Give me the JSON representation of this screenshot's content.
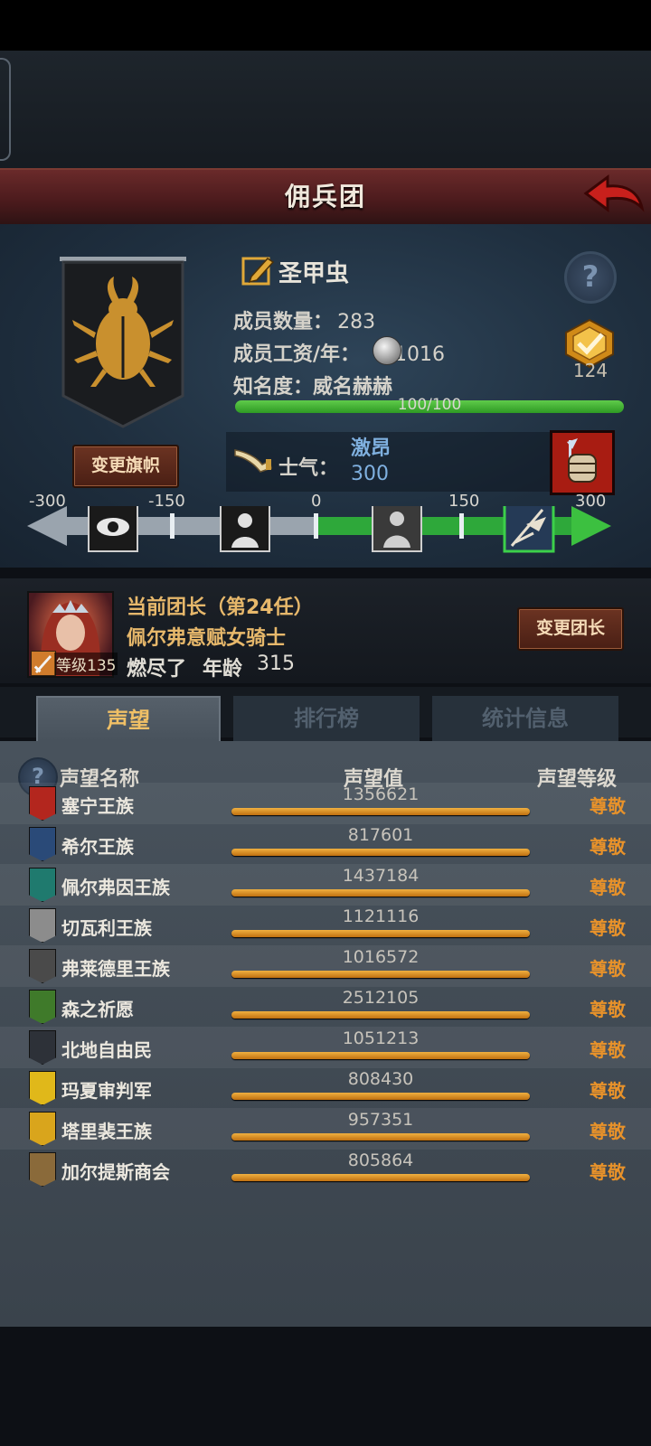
{
  "header": {
    "title": "佣兵团"
  },
  "guild": {
    "banner_button": "变更旗帜",
    "name": "圣甲虫",
    "members_label": "成员数量：",
    "members_value": "283",
    "wage_label": "成员工资/年：",
    "wage_value": "1016",
    "fame_label": "知名度：",
    "fame_value": "威名赫赫",
    "fame_progress": "100/100",
    "fame_fraction": 1.0,
    "rank_badge_value": "124",
    "morale_label": "士气：",
    "morale_state": "激昂",
    "morale_value": "300"
  },
  "morale_track": {
    "ticks": [
      "-300",
      "-150",
      "0",
      "150",
      "300"
    ],
    "current_value": 300
  },
  "leader": {
    "title": "当前团长（第24任）",
    "name": "佩尔弗意赋女骑士",
    "level_label": "等级135",
    "state": "燃尽了",
    "age_label": "年龄",
    "age_value": "315",
    "change_button": "变更团长"
  },
  "tabs": {
    "reputation": "声望",
    "ranking": "排行榜",
    "stats": "统计信息"
  },
  "table": {
    "col_name": "声望名称",
    "col_value": "声望值",
    "col_level": "声望等级",
    "rows": [
      {
        "name": "塞宁王族",
        "value": "1356621",
        "level": "尊敬",
        "emblem_color": "#b3261e"
      },
      {
        "name": "希尔王族",
        "value": "817601",
        "level": "尊敬",
        "emblem_color": "#2a4a78"
      },
      {
        "name": "佩尔弗因王族",
        "value": "1437184",
        "level": "尊敬",
        "emblem_color": "#1f7a6e"
      },
      {
        "name": "切瓦利王族",
        "value": "1121116",
        "level": "尊敬",
        "emblem_color": "#8c8c8c"
      },
      {
        "name": "弗莱德里王族",
        "value": "1016572",
        "level": "尊敬",
        "emblem_color": "#4a4a4a"
      },
      {
        "name": "森之祈愿",
        "value": "2512105",
        "level": "尊敬",
        "emblem_color": "#3f7a2a"
      },
      {
        "name": "北地自由民",
        "value": "1051213",
        "level": "尊敬",
        "emblem_color": "#2d3138"
      },
      {
        "name": "玛夏审判军",
        "value": "808430",
        "level": "尊敬",
        "emblem_color": "#e0b81a"
      },
      {
        "name": "塔里裴王族",
        "value": "957351",
        "level": "尊敬",
        "emblem_color": "#d9a51c"
      },
      {
        "name": "加尔提斯商会",
        "value": "805864",
        "level": "尊敬",
        "emblem_color": "#8a6a3a"
      }
    ]
  },
  "colors": {
    "accent_orange": "#e8922a",
    "fame_green": "#3fb52f",
    "tab_active": "#f0c066",
    "morale_blue": "#7fb0df"
  },
  "icons": [
    "back-arrow-icon",
    "edit-name-icon",
    "help-icon",
    "coin-icon",
    "rank-badge-icon",
    "horn-icon",
    "morale-event-icon",
    "eye-icon",
    "despair-icon",
    "calm-icon",
    "rally-icon"
  ]
}
